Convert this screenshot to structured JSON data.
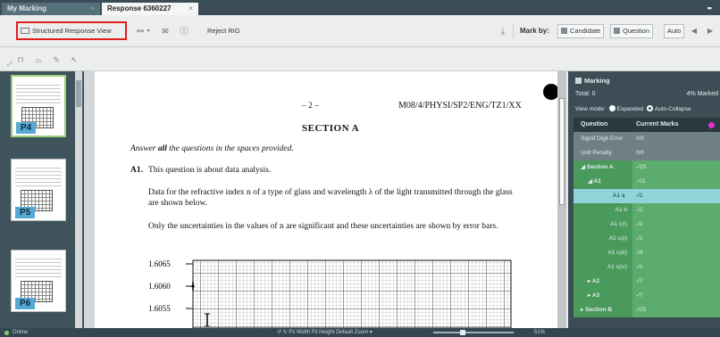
{
  "tabs": [
    {
      "label": "My Marking",
      "close": "×"
    },
    {
      "label": "Response 6360227",
      "close": "×"
    }
  ],
  "toolbar": {
    "structured_view": "Structured Response View",
    "reject": "Reject RIG",
    "mark_by": "Mark by:",
    "candidate": "Candidate",
    "question": "Question",
    "auto": "Auto"
  },
  "thumbnails": [
    {
      "label": "P4",
      "selected": true
    },
    {
      "label": "P5",
      "selected": false
    },
    {
      "label": "P6",
      "selected": false
    }
  ],
  "document": {
    "page_number": "– 2 –",
    "reference": "M08/4/PHYSI/SP2/ENG/TZ1/XX",
    "section": "SECTION A",
    "instruction_pre": "Answer",
    "instruction_bold": "all",
    "instruction_post": "the questions in the spaces provided.",
    "q_num": "A1.",
    "q_text": "This question is about data analysis.",
    "para1": "Data for the refractive index n of a type of glass and wavelength λ of the light transmitted through the glass are shown below.",
    "para2": "Only the uncertainties in the values of n are significant and these uncertainties are shown by error bars.",
    "y_ticks": [
      "1.6065",
      "1.6060",
      "1.6055"
    ]
  },
  "panel": {
    "title": "Marking",
    "total": "Total: 0",
    "percent": "4% Marked",
    "view_mode": "View mode:",
    "expanded": "Expanded",
    "auto_collapse": "Auto-Collapse",
    "col_question": "Question",
    "col_marks": "Current Marks",
    "rows": [
      {
        "q": "Signif Digit Error",
        "m": "0/0"
      },
      {
        "q": "Unit Penalty",
        "m": "0/0"
      },
      {
        "q": "Section A",
        "m": "-/25"
      },
      {
        "q": "A1",
        "m": "-/11"
      },
      {
        "q": "A1 a",
        "m": "-/1"
      },
      {
        "q": "A1 b",
        "m": "-/2"
      },
      {
        "q": "A1 c(i)",
        "m": "-/2"
      },
      {
        "q": "A1 c(ii)",
        "m": "-/1"
      },
      {
        "q": "A1 c(iii)",
        "m": "-/4"
      },
      {
        "q": "A1 c(iv)",
        "m": "-/1"
      },
      {
        "q": "A2",
        "m": "-/7"
      },
      {
        "q": "A3",
        "m": "-/7"
      },
      {
        "q": "Section B",
        "m": "-/25"
      }
    ]
  },
  "status": {
    "online": "Online",
    "controls": "Fit Width   Fit Height   Default Zoom ▾",
    "zoom": "51%"
  }
}
